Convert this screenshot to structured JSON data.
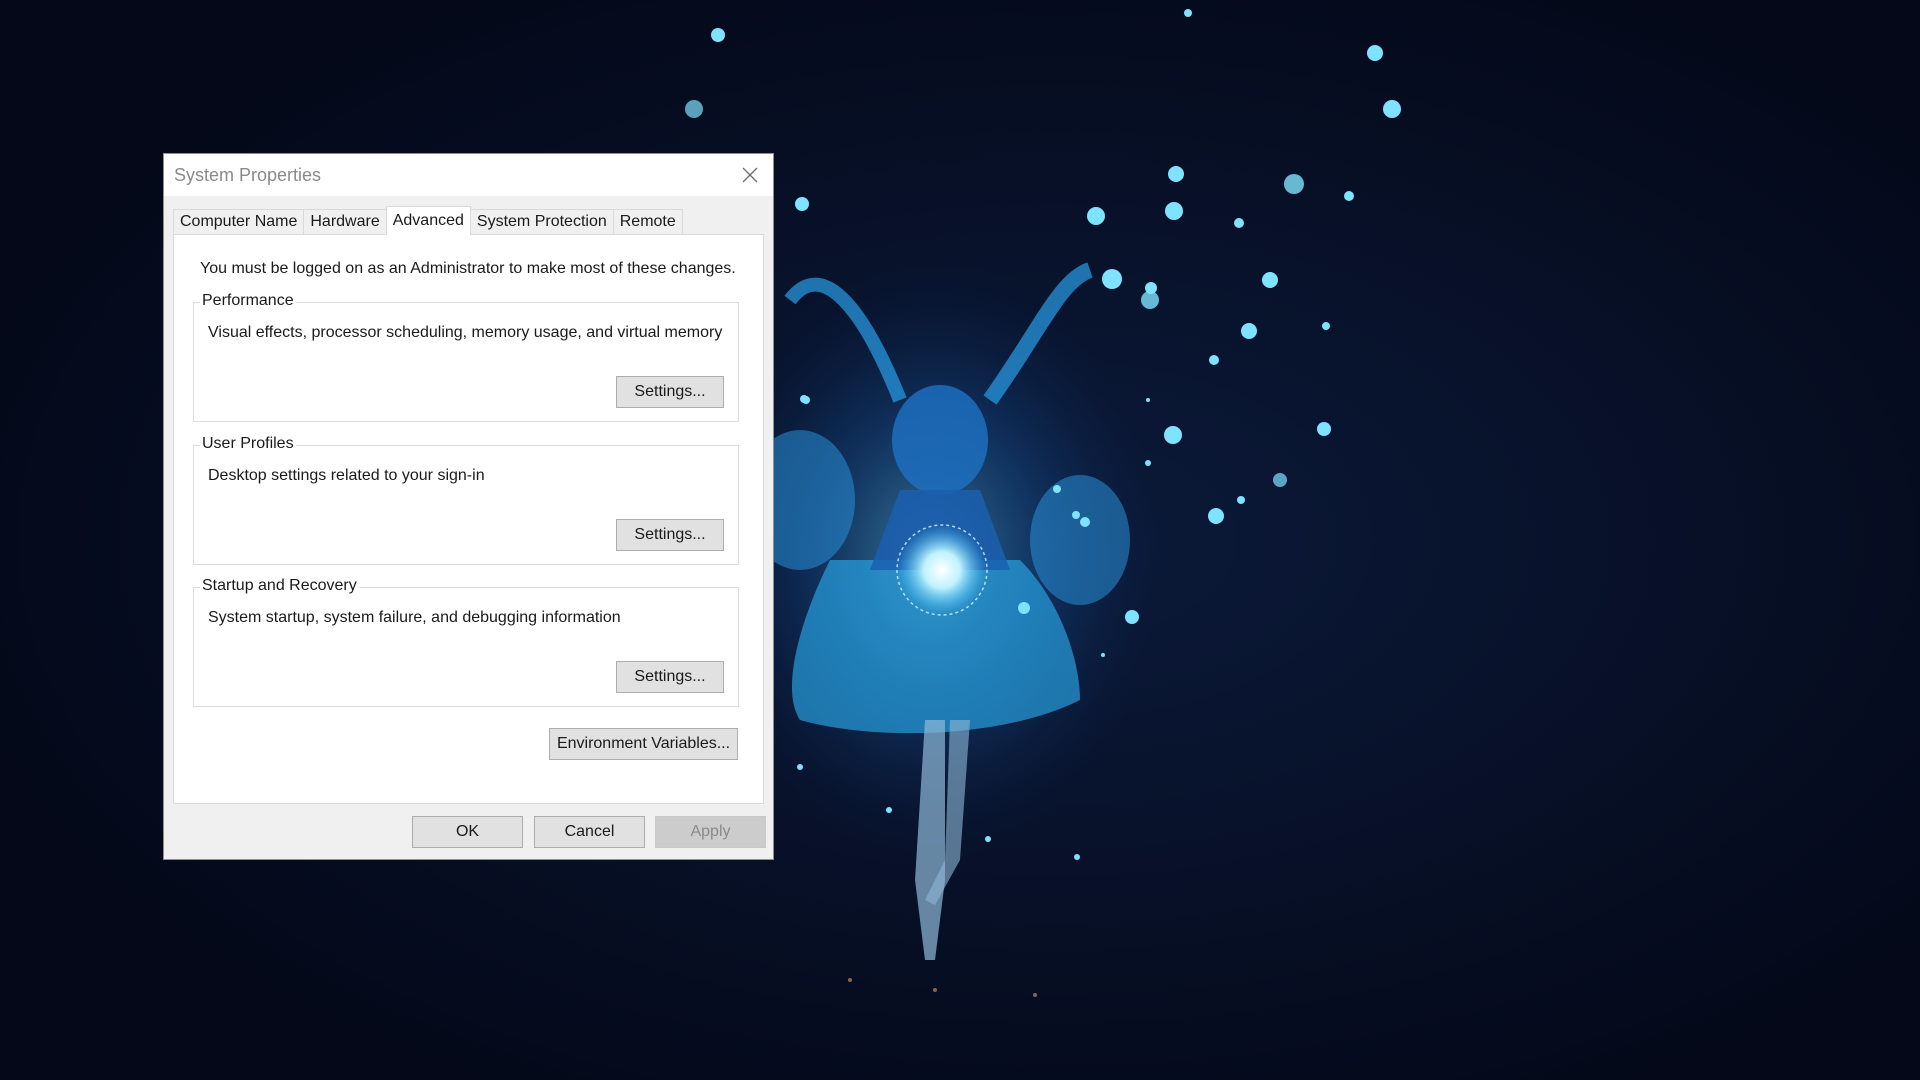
{
  "window": {
    "title": "System Properties"
  },
  "tabs": [
    {
      "label": "Computer Name"
    },
    {
      "label": "Hardware"
    },
    {
      "label": "Advanced",
      "active": true
    },
    {
      "label": "System Protection"
    },
    {
      "label": "Remote"
    }
  ],
  "notice": "You must be logged on as an Administrator to make most of these changes.",
  "groups": {
    "performance": {
      "title": "Performance",
      "description": "Visual effects, processor scheduling, memory usage, and virtual memory",
      "button": "Settings..."
    },
    "user_profiles": {
      "title": "User Profiles",
      "description": "Desktop settings related to your sign-in",
      "button": "Settings..."
    },
    "startup_recovery": {
      "title": "Startup and Recovery",
      "description": "System startup, system failure, and debugging information",
      "button": "Settings..."
    }
  },
  "env_button": "Environment Variables...",
  "footer": {
    "ok": "OK",
    "cancel": "Cancel",
    "apply": "Apply"
  },
  "icons": {
    "close": "close-icon"
  },
  "colors": {
    "desktop_background": "#050a1c",
    "glow_accent": "#3fc3ff",
    "dialog_background": "#f0f0f0",
    "panel_background": "#ffffff",
    "disabled_text": "#8a8a8a"
  }
}
